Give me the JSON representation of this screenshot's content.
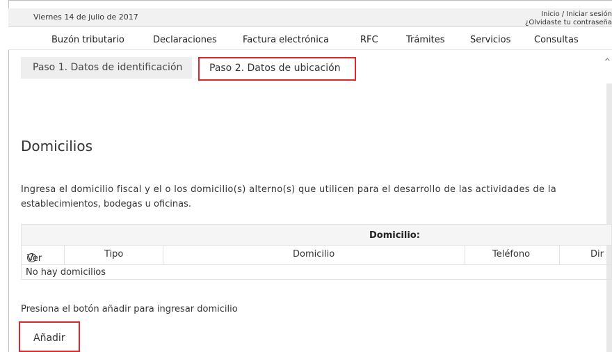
{
  "header": {
    "date": "Viernes 14 de julio de 2017",
    "login_link": "Inicio / Iniciar sesión",
    "forgot_password": "¿Olvidaste tu contraseña"
  },
  "nav": {
    "items": [
      "Buzón tributario",
      "Declaraciones",
      "Factura electrónica",
      "RFC",
      "Trámites",
      "Servicios",
      "Consultas"
    ]
  },
  "tabs": {
    "step1": "Paso 1. Datos de identificación",
    "step2": "Paso 2. Datos de ubicación"
  },
  "section": {
    "title": "Domicilios",
    "description_line1": "Ingresa el domicilio fiscal y el o los domicilio(s) alterno(s) que utilicen para el desarrollo de las actividades de la",
    "description_line2": "establecimientos, bodegas u oficinas."
  },
  "table": {
    "caption": "Domicilio:",
    "columns": [
      "Ver",
      "Tipo",
      "Domicilio",
      "Teléfono",
      "Dir"
    ],
    "empty_text": "No hay domicilios"
  },
  "footer": {
    "hint": "Presiona el botón añadir para ingresar domicilio",
    "add_label": "Añadir"
  },
  "colors": {
    "highlight": "#e0262b",
    "tab_bg": "#eeeeee"
  }
}
